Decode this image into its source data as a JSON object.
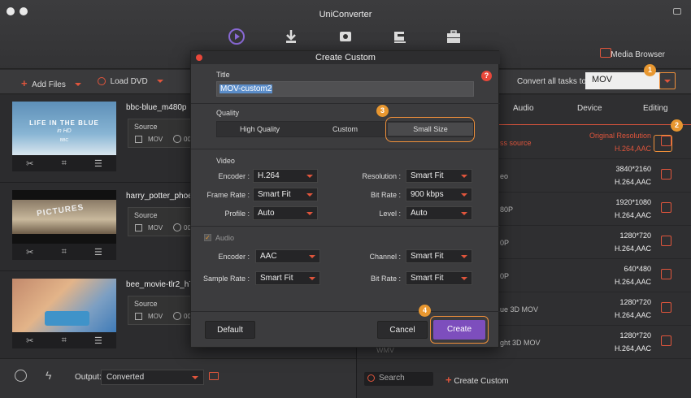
{
  "app": {
    "title": "UniConverter"
  },
  "header": {
    "media_browser": "Media Browser"
  },
  "toolbar": {
    "add_files": "Add Files",
    "load_dvd": "Load DVD",
    "convert_all_label": "Convert all tasks to:",
    "convert_all_value": "MOV"
  },
  "badges": {
    "b1": "1",
    "b2": "2",
    "b3": "3",
    "b4": "4"
  },
  "files": [
    {
      "name": "bbc-blue_m480p",
      "source_label": "Source",
      "format": "MOV",
      "duration": "00",
      "thumb_text_1": "LIFE IN THE BLUE",
      "thumb_text_2": "in HD",
      "thumb_text_3": "BBC"
    },
    {
      "name": "harry_potter_phoe",
      "source_label": "Source",
      "format": "MOV",
      "duration": "00",
      "thumb_text_1": "PICTURES"
    },
    {
      "name": "bee_movie-tlr2_h7",
      "source_label": "Source",
      "format": "MOV",
      "duration": "00"
    }
  ],
  "panel": {
    "tabs": [
      "Audio",
      "Device",
      "Editing"
    ],
    "rows": [
      {
        "label": "ss source",
        "res": "Original Resolution",
        "codec": "H.264,AAC"
      },
      {
        "label": "eo",
        "res": "3840*2160",
        "codec": "H.264,AAC"
      },
      {
        "label": "80P",
        "res": "1920*1080",
        "codec": "H.264,AAC"
      },
      {
        "label": "0P",
        "res": "1280*720",
        "codec": "H.264,AAC"
      },
      {
        "label": "0P",
        "res": "640*480",
        "codec": "H.264,AAC"
      },
      {
        "label": "ue 3D MOV",
        "res": "1280*720",
        "codec": "H.264,AAC"
      },
      {
        "label": "ght 3D MOV",
        "res": "1280*720",
        "codec": "H.264,AAC"
      }
    ],
    "wmv": "WMV",
    "search_placeholder": "Search",
    "create_custom": "Create Custom"
  },
  "bottombar": {
    "output_label": "Output:",
    "output_value": "Converted"
  },
  "modal": {
    "title": "Create Custom",
    "title_label": "Title",
    "title_value": "MOV-custom2",
    "help": "?",
    "quality_label": "Quality",
    "quality_options": [
      "High Quality",
      "Custom",
      "Small Size"
    ],
    "video_label": "Video",
    "video": {
      "encoder_label": "Encoder :",
      "encoder": "H.264",
      "framerate_label": "Frame Rate :",
      "framerate": "Smart Fit",
      "profile_label": "Profile :",
      "profile": "Auto",
      "resolution_label": "Resolution :",
      "resolution": "Smart Fit",
      "bitrate_label": "Bit Rate :",
      "bitrate": "900 kbps",
      "level_label": "Level :",
      "level": "Auto"
    },
    "audio_label": "Audio",
    "audio_check": "✓",
    "audio": {
      "encoder_label": "Encoder :",
      "encoder": "AAC",
      "samplerate_label": "Sample Rate :",
      "samplerate": "Smart Fit",
      "channel_label": "Channel :",
      "channel": "Smart Fit",
      "bitrate_label": "Bit Rate :",
      "bitrate": "Smart Fit"
    },
    "buttons": {
      "default": "Default",
      "cancel": "Cancel",
      "create": "Create"
    }
  },
  "colors": {
    "accent": "#e0553c",
    "highlight": "#f0903a",
    "primary_button": "#7d4ebd"
  }
}
